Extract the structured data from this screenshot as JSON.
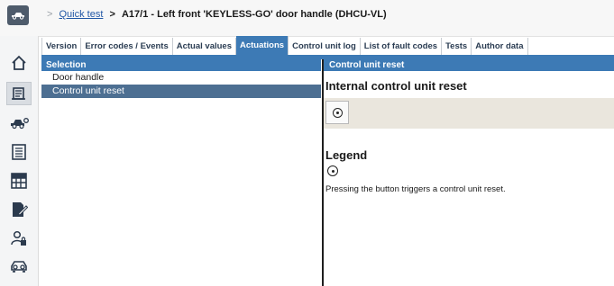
{
  "header": {
    "car_icon": "car-icon",
    "separator": ">",
    "breadcrumb_link": "Quick test",
    "breadcrumb_gt": ">",
    "breadcrumb_current": "A17/1 - Left front 'KEYLESS-GO' door handle (DHCU-VL)"
  },
  "sidebar": {
    "icons": [
      "home-icon",
      "control-unit-icon",
      "car-wrench-icon",
      "list-icon",
      "grid-icon",
      "document-edit-icon",
      "user-lock-icon",
      "vehicle-front-icon"
    ],
    "active_index": 1
  },
  "tabs": [
    {
      "label": "Version",
      "active": false
    },
    {
      "label": "Error codes / Events",
      "active": false
    },
    {
      "label": "Actual values",
      "active": false
    },
    {
      "label": "Actuations",
      "active": true
    },
    {
      "label": "Control unit log",
      "active": false
    },
    {
      "label": "List of fault codes",
      "active": false
    },
    {
      "label": "Tests",
      "active": false
    },
    {
      "label": "Author data",
      "active": false
    }
  ],
  "selection": {
    "header": "Selection",
    "items": [
      {
        "label": "Door handle",
        "selected": false
      },
      {
        "label": "Control unit reset",
        "selected": true
      }
    ]
  },
  "detail": {
    "header": "Control unit reset",
    "title": "Internal control unit reset",
    "action_icon": "reset-circle-icon",
    "legend_title": "Legend",
    "legend_icon": "reset-circle-icon",
    "legend_text": "Pressing the button triggers a control unit reset."
  },
  "colors": {
    "accent": "#3d7ab5",
    "selected_row": "#4d6f92",
    "action_bar": "#eae6dd"
  }
}
